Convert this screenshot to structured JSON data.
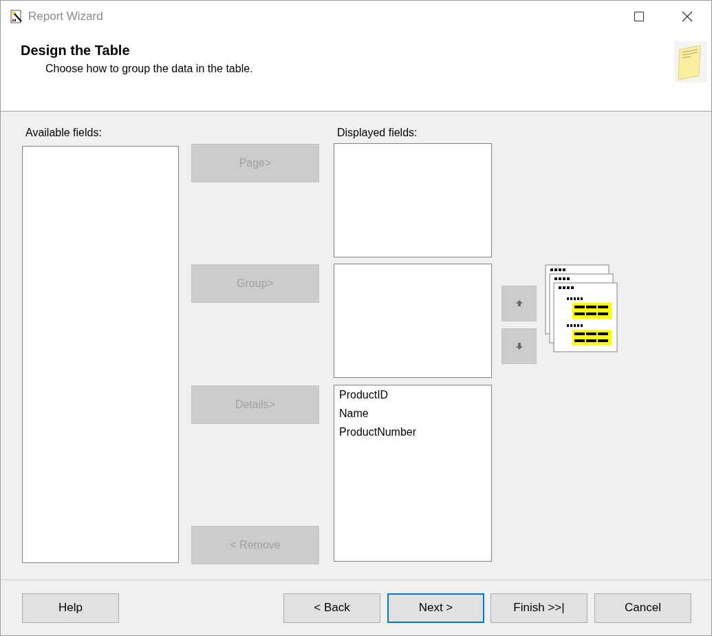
{
  "window": {
    "title": "Report Wizard"
  },
  "header": {
    "title": "Design the Table",
    "subtitle": "Choose how to group the data in the table."
  },
  "available_fields": {
    "label": "Available fields:"
  },
  "move_buttons": [
    {
      "label": "Page>",
      "disabled": true
    },
    {
      "label": "Group>",
      "disabled": true
    },
    {
      "label": "Details>",
      "disabled": true
    },
    {
      "label": "< Remove",
      "disabled": true
    }
  ],
  "displayed_fields": {
    "label": "Displayed fields:",
    "details": [
      "ProductID",
      "Name",
      "ProductNumber"
    ]
  },
  "order_buttons": [
    {
      "kind": "up",
      "disabled": true
    },
    {
      "kind": "down",
      "disabled": true
    }
  ],
  "footer_buttons": [
    {
      "label": "Help",
      "default": false
    },
    {
      "label": "< Back",
      "default": false
    },
    {
      "label": "Next >",
      "default": true
    },
    {
      "label": "Finish >>|",
      "default": false
    },
    {
      "label": "Cancel",
      "default": false
    }
  ]
}
